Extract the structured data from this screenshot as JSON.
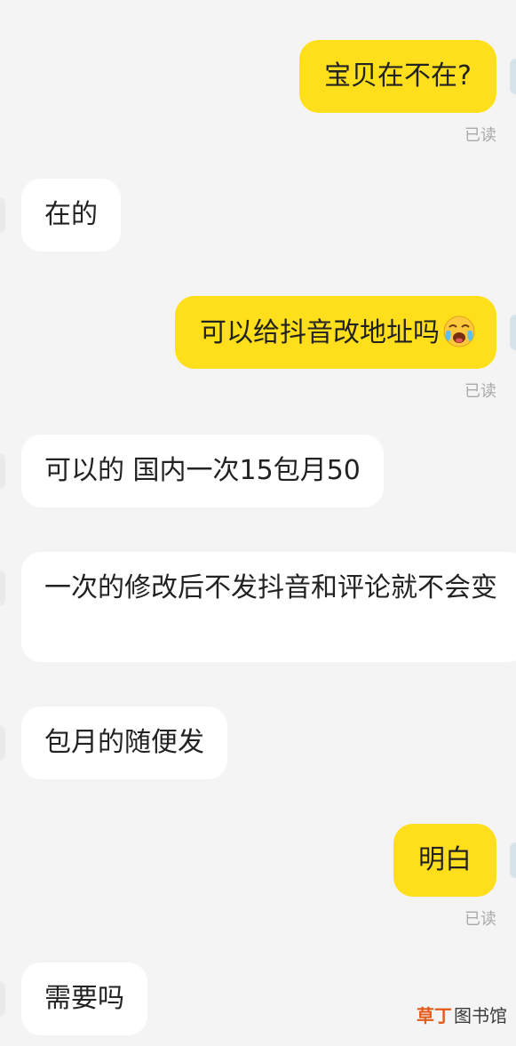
{
  "messages": [
    {
      "direction": "outgoing",
      "text": "宝贝在不在?",
      "status": "已读"
    },
    {
      "direction": "incoming",
      "text": "在的"
    },
    {
      "direction": "outgoing",
      "text": "可以给抖音改地址吗",
      "emoji": "crying-face-emoji",
      "status": "已读"
    },
    {
      "direction": "incoming",
      "text": "可以的 国内一次15包月50"
    },
    {
      "direction": "incoming",
      "text": "一次的修改后不发抖音和评论就不会变"
    },
    {
      "direction": "incoming",
      "text": "包月的随便发"
    },
    {
      "direction": "outgoing",
      "text": "明白",
      "status": "已读"
    },
    {
      "direction": "incoming",
      "text": "需要吗"
    }
  ],
  "watermark": {
    "part1": "草丁",
    "part2": "图书馆"
  },
  "colors": {
    "outgoing_bubble": "#ffdf1c",
    "incoming_bubble": "#ffffff",
    "background": "#f4f4f4",
    "read_status": "#a9a9a9"
  }
}
